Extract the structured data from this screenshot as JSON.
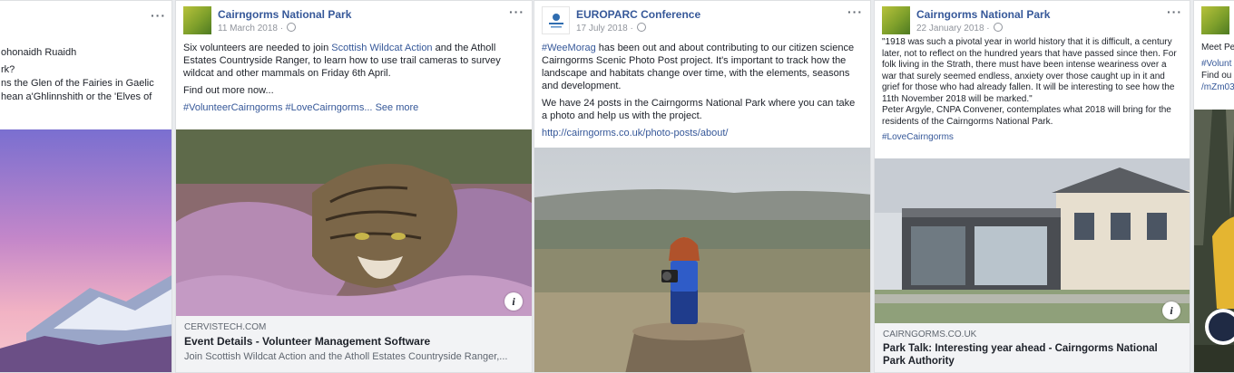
{
  "card0": {
    "lines": [
      "ohonaidh Ruaidh",
      "rk?",
      "ns the Glen of the Fairies in Gaelic",
      "hean a'Ghlinnshith or the 'Elves of"
    ]
  },
  "card1": {
    "page_name": "Cairngorms National Park",
    "date": "11 March 2018 ·",
    "text_a": "Six volunteers are needed to join ",
    "link_a": "Scottish Wildcat Action",
    "text_b": " and the Atholl Estates Countryside Ranger, to learn how to use trail cameras to survey wildcat and other mammals on Friday 6th April.",
    "text_c": "Find out more now...",
    "hashtags": "#VolunteerCairngorms #LoveCairngorms...",
    "see_more": "See more",
    "link_domain": "CERVISTECH.COM",
    "link_title": "Event Details - Volunteer Management Software",
    "link_desc": "Join Scottish Wildcat Action and the Atholl Estates Countryside Ranger,..."
  },
  "card2": {
    "page_name": "EUROPARC Conference",
    "date": "17 July 2018 ·",
    "hashtag": "#WeeMorag",
    "text_a": " has been out and about contributing to our citizen science Cairngorms Scenic Photo Post project. It's important to track how the landscape and habitats change over time, with the elements, seasons and development.",
    "text_b": "We have 24 posts in the Cairngorms National Park where you can take a photo and help us with the project.",
    "url": "http://cairngorms.co.uk/photo-posts/about/"
  },
  "card3": {
    "page_name": "Cairngorms National Park",
    "date": "22 January 2018 ·",
    "quote": "\"1918 was such a pivotal year in world history that it is difficult, a century later, not to reflect on the hundred years that have passed since then. For folk living in the Strath, there must have been intense weariness over a war that surely seemed endless, anxiety over those caught up in it and grief for those who had already fallen. It will be interesting to see how the 11th November 2018 will be marked.\"",
    "attribution": "Peter Argyle, CNPA Convener, contemplates what 2018 will bring for the residents of the Cairngorms National Park.",
    "hashtag": "#LoveCairngorms",
    "link_domain": "CAIRNGORMS.CO.UK",
    "link_title": "Park Talk: Interesting year ahead - Cairngorms National Park Authority"
  },
  "card4": {
    "lines": [
      "Meet Pe",
      "#Volunt",
      "Find ou",
      "/mZm03"
    ]
  },
  "info_glyph": "i",
  "more_glyph": "···"
}
